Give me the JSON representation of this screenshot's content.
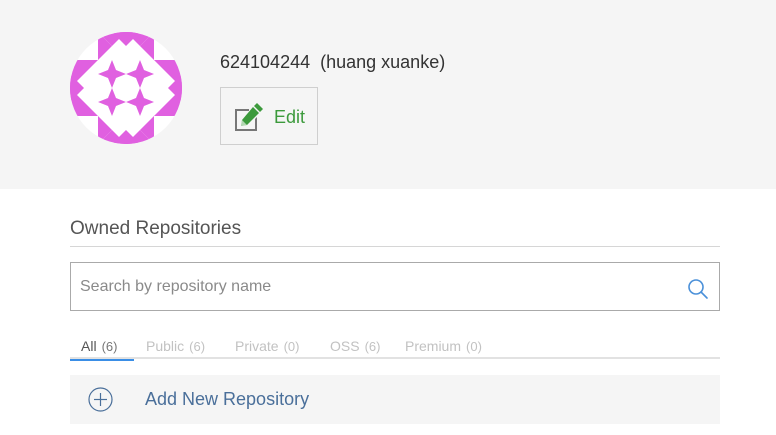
{
  "profile": {
    "user_id": "624104244",
    "full_name": "(huang xuanke)",
    "edit_label": "Edit",
    "avatar_color": "#e060e0"
  },
  "repositories": {
    "section_title": "Owned Repositories",
    "search_placeholder": "Search by repository name",
    "search_value": "",
    "tabs": [
      {
        "label": "All",
        "count": "(6)",
        "active": true
      },
      {
        "label": "Public",
        "count": "(6)",
        "active": false
      },
      {
        "label": "Private",
        "count": "(0)",
        "active": false
      },
      {
        "label": "OSS",
        "count": "(6)",
        "active": false
      },
      {
        "label": "Premium",
        "count": "(0)",
        "active": false
      }
    ],
    "add_label": "Add New Repository"
  },
  "colors": {
    "header_background": "#f5f5f5",
    "edit_green": "#3c9a3c",
    "active_tab_underline": "#3a8ee6",
    "link_blue": "#4a6f9a"
  }
}
